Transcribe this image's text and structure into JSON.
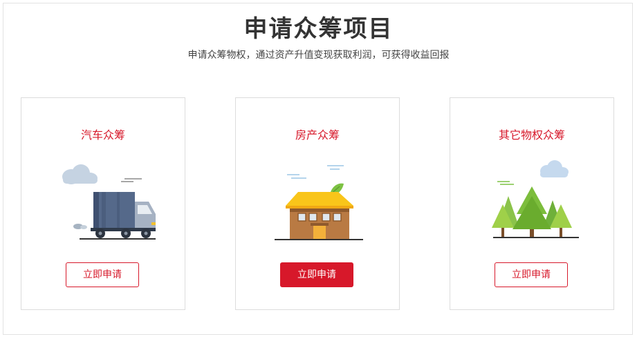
{
  "header": {
    "title": "申请众筹项目",
    "subtitle": "申请众筹物权，通过资产升值变现获取利润，可获得收益回报"
  },
  "cards": [
    {
      "title": "汽车众筹",
      "button": "立即申请",
      "icon": "truck-icon"
    },
    {
      "title": "房产众筹",
      "button": "立即申请",
      "icon": "house-icon"
    },
    {
      "title": "其它物权众筹",
      "button": "立即申请",
      "icon": "trees-icon"
    }
  ],
  "colors": {
    "accent": "#d7182a",
    "border": "#dcdcdc"
  }
}
